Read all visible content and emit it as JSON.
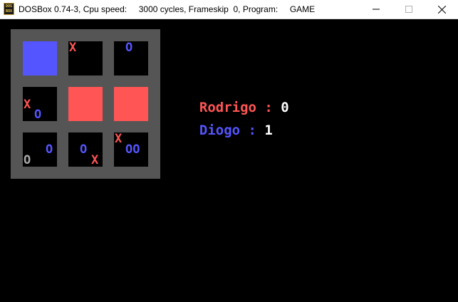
{
  "window": {
    "app_icon_text": "DOS BOX",
    "title": "DOSBox 0.74-3, Cpu speed:     3000 cycles, Frameskip  0, Program:     GAME",
    "minimize_icon": "minimize-icon",
    "maximize_icon": "maximize-icon",
    "close_icon": "close-icon"
  },
  "colors": {
    "board": "#555555",
    "red": "#ff5555",
    "blue": "#5555ff",
    "gray": "#aaaaaa",
    "white": "#ffffff"
  },
  "board": {
    "rows": [
      [
        {
          "fill": "blue",
          "marks": []
        },
        {
          "fill": "",
          "marks": [
            {
              "symbol": "X",
              "color": "red"
            }
          ]
        },
        {
          "fill": "",
          "marks": [
            {
              "symbol": "O",
              "color": "blue"
            }
          ]
        }
      ],
      [
        {
          "fill": "",
          "marks": [
            {
              "symbol": "X",
              "color": "red"
            },
            {
              "symbol": "O",
              "color": "blue"
            }
          ]
        },
        {
          "fill": "red",
          "marks": []
        },
        {
          "fill": "red",
          "marks": []
        }
      ],
      [
        {
          "fill": "",
          "marks": [
            {
              "symbol": "O",
              "color": "blue"
            },
            {
              "symbol": "O",
              "color": "gray"
            }
          ]
        },
        {
          "fill": "",
          "marks": [
            {
              "symbol": "O",
              "color": "blue"
            },
            {
              "symbol": "X",
              "color": "red"
            }
          ]
        },
        {
          "fill": "",
          "marks": [
            {
              "symbol": "X",
              "color": "red"
            },
            {
              "symbol": "OO",
              "color": "blue"
            }
          ]
        }
      ]
    ]
  },
  "scores": {
    "player1": {
      "name": "Rodrigo",
      "separator": " : ",
      "score": "0"
    },
    "player2": {
      "name": "Diogo",
      "separator": " : ",
      "score": "1"
    }
  }
}
